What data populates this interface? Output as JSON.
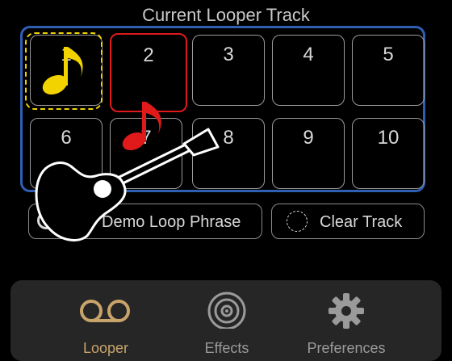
{
  "header": {
    "title": "Current Looper Track"
  },
  "tracks": [
    "1",
    "2",
    "3",
    "4",
    "5",
    "6",
    "7",
    "8",
    "9",
    "10"
  ],
  "buttons": {
    "demo_label": "Demo Loop Phrase",
    "clear_label": "Clear Track"
  },
  "tabs": [
    {
      "label": "Looper",
      "icon": "cassette-tape-icon",
      "color": "#c8a46a"
    },
    {
      "label": "Effects",
      "icon": "vinyl-record-icon",
      "color": "#9a9a9a"
    },
    {
      "label": "Preferences",
      "icon": "gear-icon",
      "color": "#9a9a9a"
    }
  ],
  "colors": {
    "accent_blue": "#2f5fb3",
    "selected_yellow": "#f0d400",
    "active_red": "#e01a1a"
  }
}
